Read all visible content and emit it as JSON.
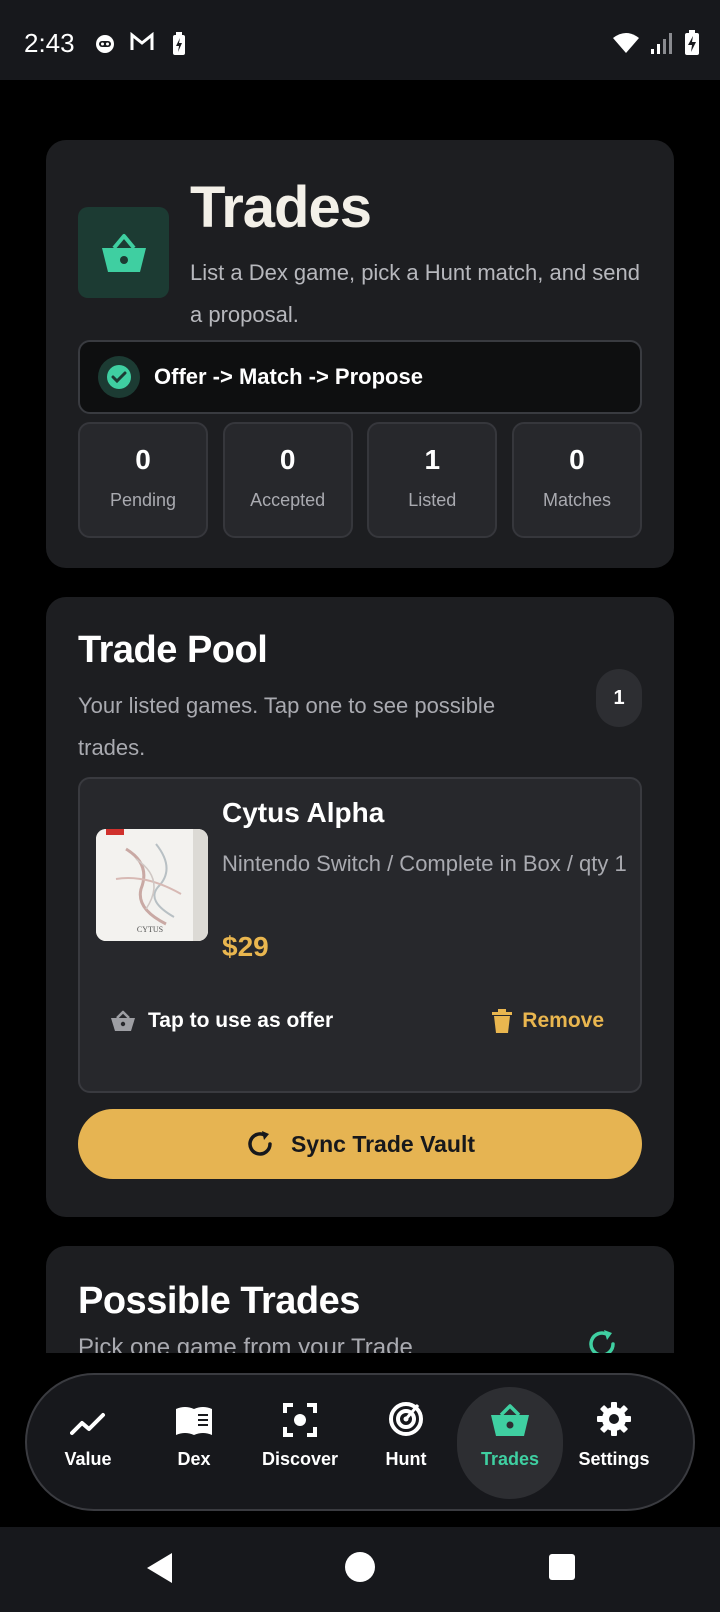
{
  "status_bar": {
    "time": "2:43",
    "left_icons": [
      "robot-face-icon",
      "gmail-icon",
      "battery-saver-icon"
    ],
    "right_icons": [
      "wifi-icon",
      "signal-icon",
      "battery-charging-icon"
    ]
  },
  "header": {
    "title": "Trades",
    "subtitle": "List a Dex game, pick a Hunt match, and send a proposal.",
    "flow_text": "Offer -> Match -> Propose",
    "stats": [
      {
        "value": "0",
        "label": "Pending"
      },
      {
        "value": "0",
        "label": "Accepted"
      },
      {
        "value": "1",
        "label": "Listed"
      },
      {
        "value": "0",
        "label": "Matches"
      }
    ]
  },
  "trade_pool": {
    "title": "Trade Pool",
    "subtitle": "Your listed games. Tap one to see possible trades.",
    "count": "1",
    "items": [
      {
        "title": "Cytus Alpha",
        "meta": "Nintendo Switch / Complete in Box / qty 1",
        "price": "$29",
        "offer_label": "Tap to use as offer",
        "remove_label": "Remove",
        "thumb_caption": "CYTUS"
      }
    ],
    "sync_label": "Sync Trade Vault"
  },
  "possible_trades": {
    "title": "Possible Trades",
    "subtitle": "Pick one game from your Trade"
  },
  "bottom_nav": {
    "items": [
      {
        "label": "Value",
        "icon": "trend-line-icon"
      },
      {
        "label": "Dex",
        "icon": "book-icon"
      },
      {
        "label": "Discover",
        "icon": "scan-icon"
      },
      {
        "label": "Hunt",
        "icon": "radar-icon"
      },
      {
        "label": "Trades",
        "icon": "basket-icon",
        "active": true
      },
      {
        "label": "Settings",
        "icon": "gear-icon"
      }
    ]
  },
  "colors": {
    "accent_green": "#3fcfa1",
    "accent_gold": "#e6b452",
    "card_bg": "#1d1e21"
  }
}
